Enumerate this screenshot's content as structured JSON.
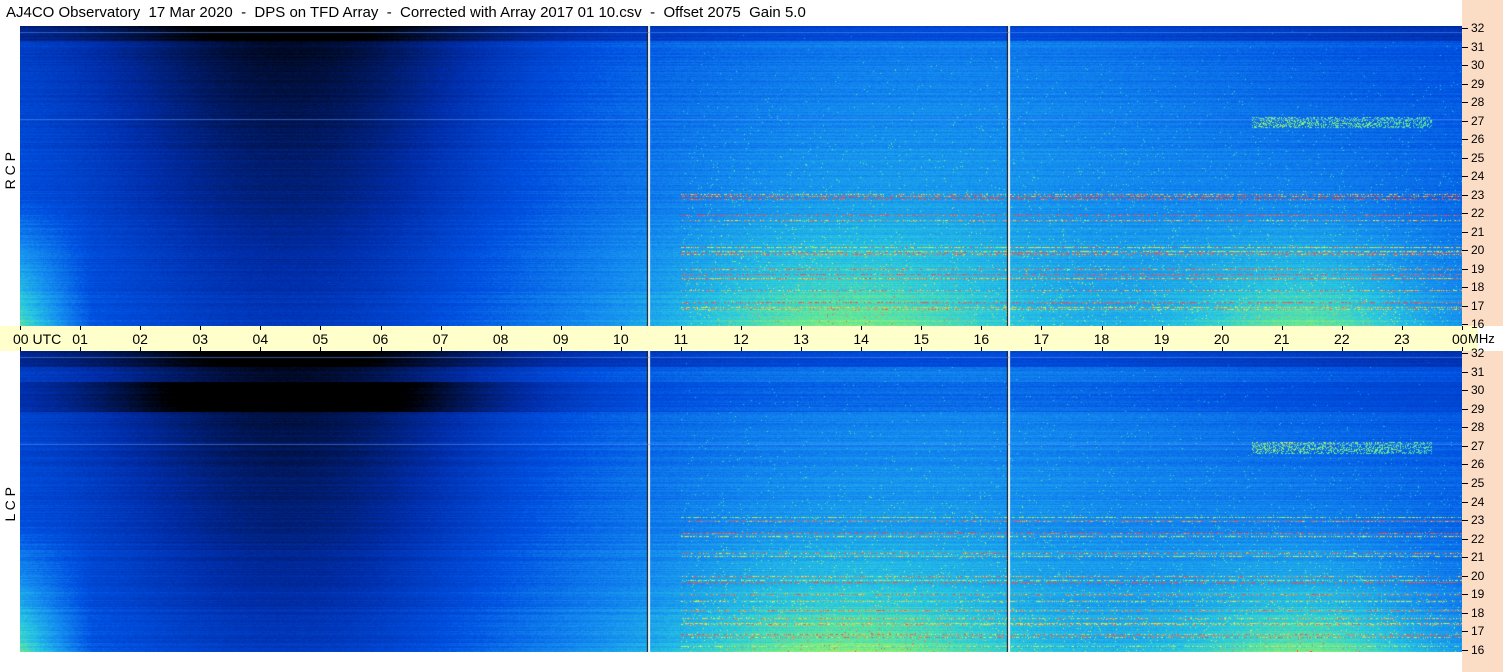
{
  "title": "AJ4CO Observatory  17 Mar 2020  -  DPS on TFD Array  -  Corrected with Array 2017 01 10.csv  -  Offset 2075  Gain 5.0",
  "panels": [
    {
      "id": "rcp",
      "label": "R C P"
    },
    {
      "id": "lcp",
      "label": "L C P"
    }
  ],
  "time_axis": {
    "labels": [
      "00 UTC",
      "01",
      "02",
      "03",
      "04",
      "05",
      "06",
      "07",
      "08",
      "09",
      "10",
      "11",
      "12",
      "13",
      "14",
      "15",
      "16",
      "17",
      "18",
      "19",
      "20",
      "21",
      "22",
      "23",
      "00"
    ],
    "unit": "MHz"
  },
  "freq_axis": {
    "labels": [
      "32",
      "31",
      "30",
      "29",
      "28",
      "27",
      "26",
      "25",
      "24",
      "23",
      "22",
      "21",
      "20",
      "19",
      "18",
      "17",
      "16"
    ]
  },
  "colors": {
    "background": "#ffffff",
    "time_axis_bg": "#ffffcc",
    "freq_axis_bg": "#fbdcc5",
    "colormap": [
      "#000000",
      "#001660",
      "#0030b0",
      "#0050e0",
      "#1a8ff0",
      "#30d0e0",
      "#80f080",
      "#f0f040",
      "#ff4040"
    ]
  },
  "chart_data": {
    "type": "heatmap",
    "title": "AJ4CO Observatory  17 Mar 2020  -  DPS on TFD Array  -  Corrected with Array 2017 01 10.csv  -  Offset 2075  Gain 5.0",
    "xlabel": "UTC",
    "ylabel": "MHz",
    "xlim": [
      0,
      24
    ],
    "ylim": [
      16,
      32
    ],
    "x_ticks": [
      0,
      1,
      2,
      3,
      4,
      5,
      6,
      7,
      8,
      9,
      10,
      11,
      12,
      13,
      14,
      15,
      16,
      17,
      18,
      19,
      20,
      21,
      22,
      23,
      24
    ],
    "y_ticks": [
      16,
      17,
      18,
      19,
      20,
      21,
      22,
      23,
      24,
      25,
      26,
      27,
      28,
      29,
      30,
      31,
      32
    ],
    "panels": [
      "R C P",
      "L C P"
    ],
    "discontinuities_utc": [
      10.45,
      16.45
    ],
    "series": [
      {
        "name": "R C P"
      },
      {
        "name": "L C P"
      }
    ]
  }
}
